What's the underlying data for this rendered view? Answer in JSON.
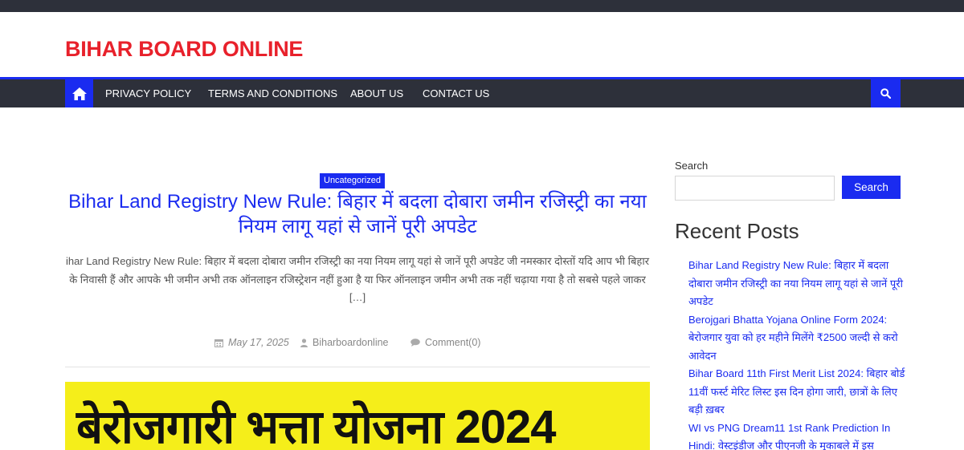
{
  "site": {
    "title": "BIHAR BOARD ONLINE"
  },
  "nav": {
    "items": [
      {
        "label": "PRIVACY POLICY"
      },
      {
        "label": "TERMS AND CONDITIONS"
      },
      {
        "label": "ABOUT US"
      },
      {
        "label": "CONTACT US"
      }
    ],
    "home_icon": "home-icon",
    "search_icon": "search-icon"
  },
  "post": {
    "category": "Uncategorized",
    "title": "Bihar Land Registry New Rule: बिहार में बदला दोबारा जमीन रजिस्ट्री का नया नियम लागू यहां से जानें पूरी अपडेट",
    "excerpt": "ihar Land Registry New Rule: बिहार में बदला दोबारा जमीन रजिस्ट्री का नया नियम लागू यहां से जानें पूरी अपडेट जी नमस्कार दोस्तों यदि आप भी बिहार के निवासी हैं और आपके भी जमीन अभी तक ऑनलाइन रजिस्ट्रेशन नहीं हुआ है या फिर ऑनलाइन जमीन अभी तक नहीं चढ़ाया गया है तो सबसे पहले जाकर […]",
    "date": "May 17, 2025",
    "author": "Biharboardonline",
    "comments": "Comment(0)"
  },
  "banner": {
    "text": "बेरोजगारी भत्ता योजना 2024"
  },
  "sidebar": {
    "search_label": "Search",
    "search_value": "",
    "search_button": "Search",
    "recent_heading": "Recent Posts",
    "recent_posts": [
      "Bihar Land Registry New Rule: बिहार में बदला दोबारा जमीन रजिस्ट्री का नया नियम लागू यहां से जानें पूरी अपडेट",
      "Berojgari Bhatta Yojana Online Form 2024: बेरोजगार युवा को हर महीने मिलेंगे ₹2500 जल्दी से करो आवेदन",
      "Bihar Board 11th First Merit List 2024: बिहार बोर्ड 11वीं फर्स्ट मेरिट लिस्ट इस दिन होगा जारी, छात्रों के लिए बड़ी ख़बर",
      "WI vs PNG Dream11 1st Rank Prediction In Hindi: वेस्टइंडीज और पीएनजी के मुकाबले में इस"
    ]
  },
  "colors": {
    "accent": "#1a2bf0",
    "brand": "#e8212b",
    "dark": "#2d303a",
    "banner": "#f5ee1a"
  }
}
